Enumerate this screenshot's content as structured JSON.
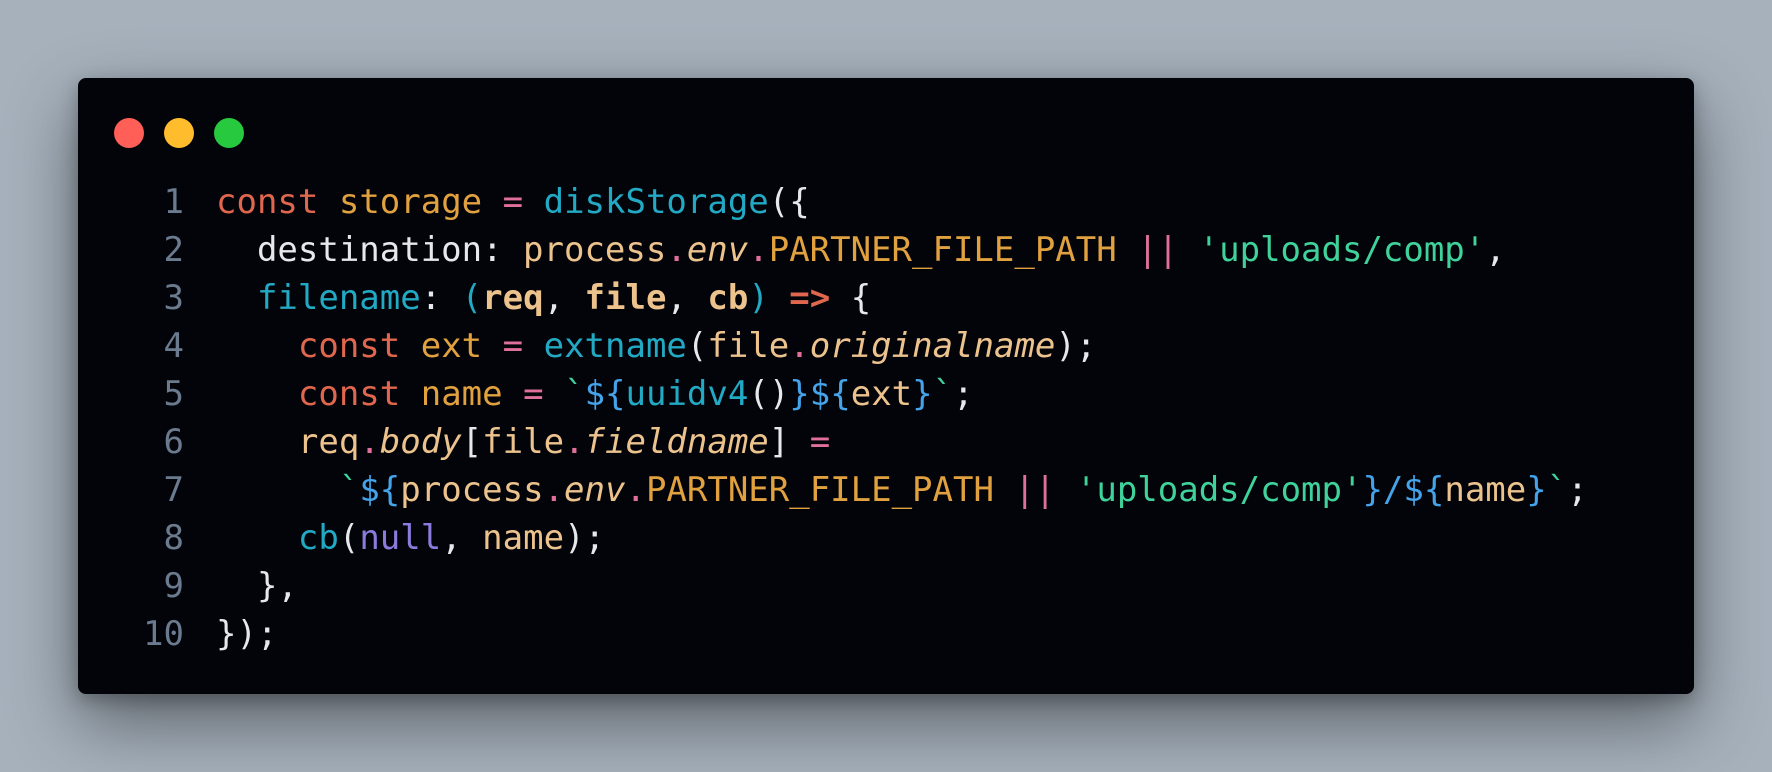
{
  "window": {
    "controls": [
      {
        "name": "close",
        "color": "#ff5f56"
      },
      {
        "name": "minimize",
        "color": "#ffbd2e"
      },
      {
        "name": "maximize",
        "color": "#27c93f"
      }
    ]
  },
  "colors": {
    "background": "#a6b1bc",
    "editor": "#03040a",
    "line_number": "#6b7b8f",
    "keyword": "#e0674e",
    "variable": "#e0a13e",
    "operator": "#e0709a",
    "function": "#22a9c4",
    "default": "#e6e8ec",
    "param": "#edc38d",
    "string": "#3fd39b",
    "template": "#44a3e9",
    "null": "#8c7bdc"
  },
  "code": {
    "lines": [
      {
        "num": "1",
        "tokens": [
          {
            "t": "const",
            "c": "keyword"
          },
          {
            "t": " "
          },
          {
            "t": "storage",
            "c": "variable"
          },
          {
            "t": " "
          },
          {
            "t": "=",
            "c": "operator"
          },
          {
            "t": " "
          },
          {
            "t": "diskStorage",
            "c": "function"
          },
          {
            "t": "({",
            "c": "default"
          }
        ]
      },
      {
        "num": "2",
        "tokens": [
          {
            "t": "  destination: ",
            "c": "default"
          },
          {
            "t": "process",
            "c": "param"
          },
          {
            "t": ".",
            "c": "operator"
          },
          {
            "t": "env",
            "c": "param",
            "s": "i"
          },
          {
            "t": ".",
            "c": "operator"
          },
          {
            "t": "PARTNER_FILE_PATH",
            "c": "variable"
          },
          {
            "t": " "
          },
          {
            "t": "||",
            "c": "operator"
          },
          {
            "t": " "
          },
          {
            "t": "'uploads/comp'",
            "c": "string"
          },
          {
            "t": ",",
            "c": "default"
          }
        ]
      },
      {
        "num": "3",
        "tokens": [
          {
            "t": "  "
          },
          {
            "t": "filename",
            "c": "function"
          },
          {
            "t": ": ",
            "c": "default"
          },
          {
            "t": "(",
            "c": "function"
          },
          {
            "t": "req",
            "c": "param",
            "s": "b"
          },
          {
            "t": ", ",
            "c": "default"
          },
          {
            "t": "file",
            "c": "param",
            "s": "b"
          },
          {
            "t": ", ",
            "c": "default"
          },
          {
            "t": "cb",
            "c": "param",
            "s": "b"
          },
          {
            "t": ")",
            "c": "function"
          },
          {
            "t": " "
          },
          {
            "t": "=>",
            "c": "keyword",
            "s": "b"
          },
          {
            "t": " {",
            "c": "default"
          }
        ]
      },
      {
        "num": "4",
        "tokens": [
          {
            "t": "    "
          },
          {
            "t": "const",
            "c": "keyword"
          },
          {
            "t": " "
          },
          {
            "t": "ext",
            "c": "variable"
          },
          {
            "t": " "
          },
          {
            "t": "=",
            "c": "operator"
          },
          {
            "t": " "
          },
          {
            "t": "extname",
            "c": "function"
          },
          {
            "t": "(",
            "c": "default"
          },
          {
            "t": "file",
            "c": "param"
          },
          {
            "t": ".",
            "c": "operator"
          },
          {
            "t": "originalname",
            "c": "param",
            "s": "i"
          },
          {
            "t": ");",
            "c": "default"
          }
        ]
      },
      {
        "num": "5",
        "tokens": [
          {
            "t": "    "
          },
          {
            "t": "const",
            "c": "keyword"
          },
          {
            "t": " "
          },
          {
            "t": "name",
            "c": "variable"
          },
          {
            "t": " "
          },
          {
            "t": "=",
            "c": "operator"
          },
          {
            "t": " "
          },
          {
            "t": "`",
            "c": "string"
          },
          {
            "t": "${",
            "c": "template"
          },
          {
            "t": "uuidv4",
            "c": "function"
          },
          {
            "t": "()",
            "c": "default"
          },
          {
            "t": "}${",
            "c": "template"
          },
          {
            "t": "ext",
            "c": "param"
          },
          {
            "t": "}",
            "c": "template"
          },
          {
            "t": "`",
            "c": "string"
          },
          {
            "t": ";",
            "c": "default"
          }
        ]
      },
      {
        "num": "6",
        "tokens": [
          {
            "t": "    "
          },
          {
            "t": "req",
            "c": "param"
          },
          {
            "t": ".",
            "c": "operator"
          },
          {
            "t": "body",
            "c": "param",
            "s": "i"
          },
          {
            "t": "[",
            "c": "default"
          },
          {
            "t": "file",
            "c": "param"
          },
          {
            "t": ".",
            "c": "operator"
          },
          {
            "t": "fieldname",
            "c": "param",
            "s": "i"
          },
          {
            "t": "] ",
            "c": "default"
          },
          {
            "t": "=",
            "c": "operator"
          }
        ]
      },
      {
        "num": "7",
        "tokens": [
          {
            "t": "      "
          },
          {
            "t": "`",
            "c": "string"
          },
          {
            "t": "${",
            "c": "template"
          },
          {
            "t": "process",
            "c": "param"
          },
          {
            "t": ".",
            "c": "operator"
          },
          {
            "t": "env",
            "c": "param",
            "s": "i"
          },
          {
            "t": ".",
            "c": "operator"
          },
          {
            "t": "PARTNER_FILE_PATH",
            "c": "variable"
          },
          {
            "t": " "
          },
          {
            "t": "||",
            "c": "operator"
          },
          {
            "t": " "
          },
          {
            "t": "'uploads/comp'",
            "c": "string"
          },
          {
            "t": "}/${",
            "c": "template"
          },
          {
            "t": "name",
            "c": "param"
          },
          {
            "t": "}",
            "c": "template"
          },
          {
            "t": "`",
            "c": "string"
          },
          {
            "t": ";",
            "c": "default"
          }
        ]
      },
      {
        "num": "8",
        "tokens": [
          {
            "t": "    "
          },
          {
            "t": "cb",
            "c": "function"
          },
          {
            "t": "(",
            "c": "default"
          },
          {
            "t": "null",
            "c": "null"
          },
          {
            "t": ", ",
            "c": "default"
          },
          {
            "t": "name",
            "c": "param"
          },
          {
            "t": ");",
            "c": "default"
          }
        ]
      },
      {
        "num": "9",
        "tokens": [
          {
            "t": "  },",
            "c": "default"
          }
        ]
      },
      {
        "num": "10",
        "tokens": [
          {
            "t": "});",
            "c": "default"
          }
        ]
      }
    ]
  }
}
